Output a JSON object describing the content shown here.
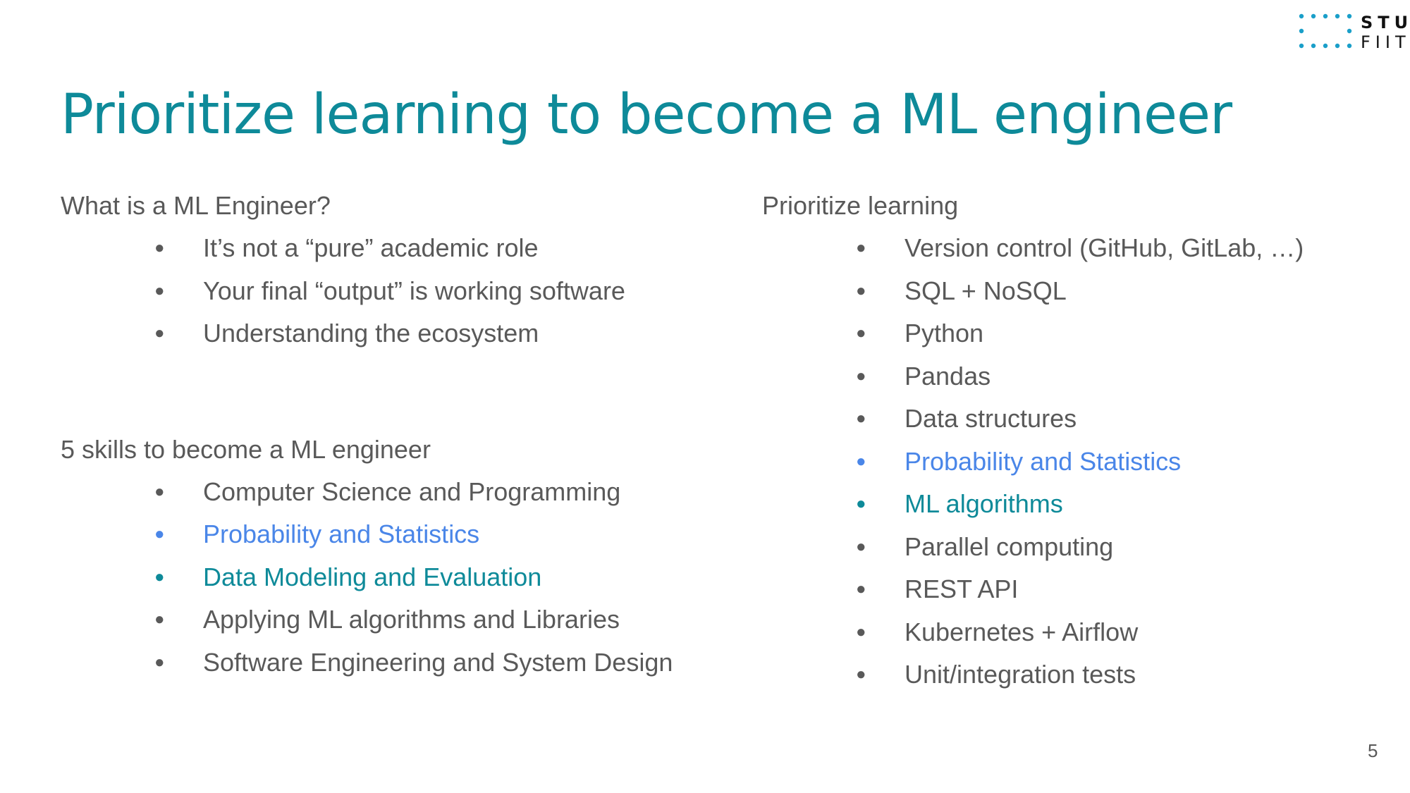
{
  "logo": {
    "line1": "STU",
    "line2": "FIIT",
    "dot_color": "#1a9fc9"
  },
  "title": "Prioritize learning to become a ML engineer",
  "left": {
    "section1": {
      "heading": "What is a ML Engineer?",
      "items": [
        {
          "text": "It’s not a “pure” academic role",
          "color": "grey"
        },
        {
          "text": "Your final “output” is working software",
          "color": "grey"
        },
        {
          "text": "Understanding the ecosystem",
          "color": "grey"
        }
      ]
    },
    "section2": {
      "heading": "5 skills to become a ML engineer",
      "items": [
        {
          "text": "Computer Science and Programming",
          "color": "grey"
        },
        {
          "text": "Probability and Statistics",
          "color": "blue"
        },
        {
          "text": "Data Modeling and Evaluation",
          "color": "teal"
        },
        {
          "text": "Applying ML algorithms and Libraries",
          "color": "grey"
        },
        {
          "text": "Software Engineering and System Design",
          "color": "grey"
        }
      ]
    }
  },
  "right": {
    "heading": "Prioritize learning",
    "items": [
      {
        "text": "Version control (GitHub, GitLab, …)",
        "color": "grey"
      },
      {
        "text": "SQL + NoSQL",
        "color": "grey"
      },
      {
        "text": "Python",
        "color": "grey"
      },
      {
        "text": "Pandas",
        "color": "grey"
      },
      {
        "text": "Data structures",
        "color": "grey"
      },
      {
        "text": "Probability and Statistics",
        "color": "blue"
      },
      {
        "text": "ML algorithms",
        "color": "teal"
      },
      {
        "text": "Parallel computing",
        "color": "grey"
      },
      {
        "text": "REST API",
        "color": "grey"
      },
      {
        "text": "Kubernetes + Airflow",
        "color": "grey"
      },
      {
        "text": "Unit/integration tests",
        "color": "grey"
      }
    ]
  },
  "bullet_glyph": "●",
  "page_number": "5",
  "colors": {
    "title": "#0e8a99",
    "grey": "#595959",
    "blue": "#4a86e8",
    "teal": "#0e8a99"
  }
}
